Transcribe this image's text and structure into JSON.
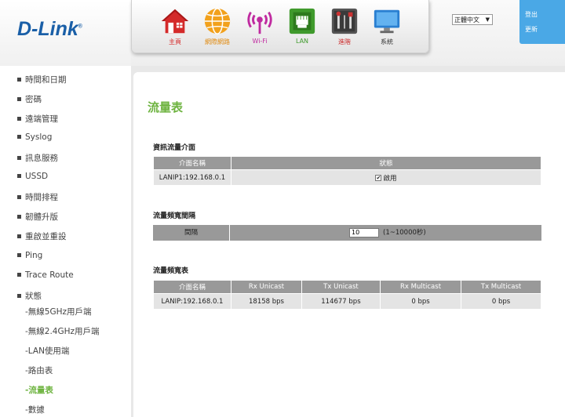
{
  "brand": "D-Link",
  "nav": [
    {
      "label": "主頁",
      "icon": "home-icon"
    },
    {
      "label": "網際網路",
      "icon": "globe-icon"
    },
    {
      "label": "Wi-Fi",
      "icon": "wifi-icon"
    },
    {
      "label": "LAN",
      "icon": "lan-icon"
    },
    {
      "label": "進階",
      "icon": "tools-icon"
    },
    {
      "label": "系統",
      "icon": "monitor-icon"
    }
  ],
  "language": "正體中文",
  "top_buttons": {
    "logout": "登出",
    "refresh": "更新"
  },
  "sidebar": [
    {
      "label": "時間和日期"
    },
    {
      "label": "密碼"
    },
    {
      "label": "遠端管理"
    },
    {
      "label": "Syslog"
    },
    {
      "label": "訊息服務"
    },
    {
      "label": "USSD"
    },
    {
      "label": "時間排程"
    },
    {
      "label": "韌體升版"
    },
    {
      "label": "重啟並重設"
    },
    {
      "label": "Ping"
    },
    {
      "label": "Trace Route"
    },
    {
      "label": "狀態"
    },
    {
      "label": "-無線5GHz用戶端"
    },
    {
      "label": "-無線2.4GHz用戶端"
    },
    {
      "label": "-LAN使用端"
    },
    {
      "label": "-路由表"
    },
    {
      "label": "-流量表"
    },
    {
      "label": "-數據"
    }
  ],
  "page_title": "流量表",
  "interfaces": {
    "title": "資訊流量介面",
    "headers": [
      "介面名稱",
      "狀態"
    ],
    "rows": [
      {
        "name": "LANIP1:192.168.0.1",
        "status": "啟用"
      }
    ]
  },
  "interval": {
    "title": "流量頻寬間隔",
    "label": "間隔",
    "value": "10",
    "hint": "(1~10000秒)"
  },
  "bandwidth": {
    "title": "流量頻寬表",
    "headers": [
      "介面名稱",
      "Rx Unicast",
      "Tx Unicast",
      "Rx Multicast",
      "Tx Multicast"
    ],
    "row": [
      "LANIP:192.168.0.1",
      "18158 bps",
      "114677 bps",
      "0 bps",
      "0 bps"
    ]
  },
  "colors": {
    "accent": "#6db33f",
    "brand": "#1a5fa7",
    "header_cell": "#999999",
    "top_button": "#4aa8e6"
  }
}
